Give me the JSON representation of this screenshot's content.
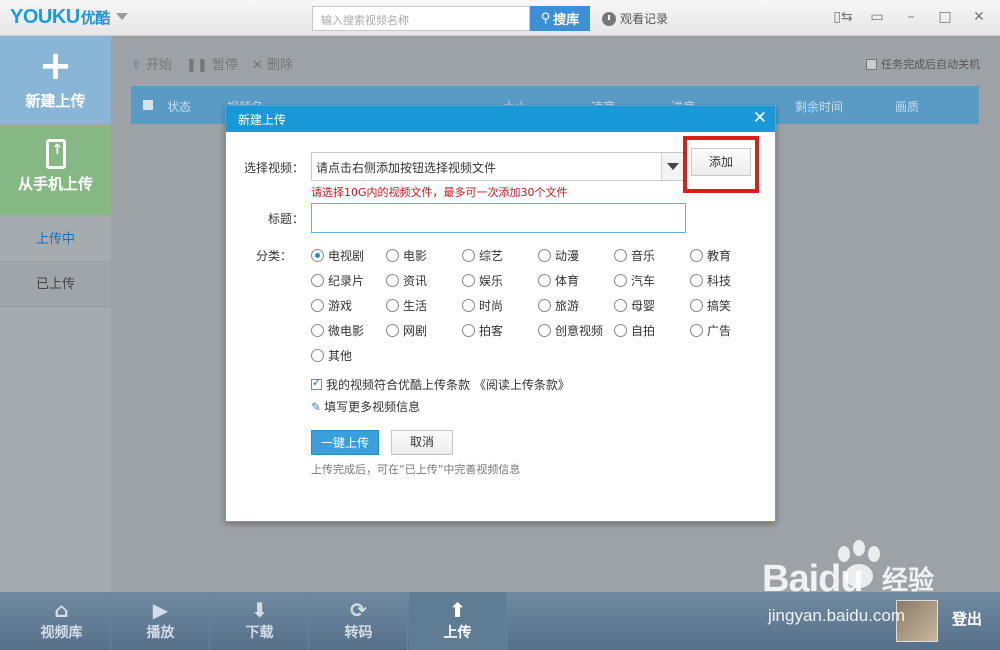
{
  "app": {
    "logo_latin": "YOUKU",
    "logo_cn": "优酷",
    "search_placeholder": "输入搜索视频名称",
    "search_button": "搜库",
    "history": "观看记录"
  },
  "sidebar": {
    "new_upload": "新建上传",
    "phone_upload": "从手机上传",
    "tab_uploading": "上传中",
    "tab_uploaded": "已上传"
  },
  "toolbar": {
    "start": "开始",
    "pause": "暂停",
    "delete": "删除",
    "auto_shutdown": "任务完成后自动关机"
  },
  "table": {
    "columns": [
      "状态",
      "视频名",
      "大小",
      "速度",
      "进度",
      "剩余时间",
      "画质"
    ]
  },
  "dialog": {
    "title": "新建上传",
    "select_label": "选择视频：",
    "select_value": "请点击右侧添加按钮选择视频文件",
    "add_button": "添加",
    "hint": "请选择10G内的视频文件，最多可一次添加30个文件",
    "title_label": "标题：",
    "category_label": "分类：",
    "categories": [
      "电视剧",
      "电影",
      "综艺",
      "动漫",
      "音乐",
      "教育",
      "纪录片",
      "资讯",
      "娱乐",
      "体育",
      "汽车",
      "科技",
      "游戏",
      "生活",
      "时尚",
      "旅游",
      "母婴",
      "搞笑",
      "微电影",
      "网剧",
      "拍客",
      "创意视频",
      "自拍",
      "广告",
      "其他"
    ],
    "selected_category": "电视剧",
    "agree_text": "我的视频符合优酷上传条款 《阅读上传条款》",
    "more_info": "填写更多视频信息",
    "upload_button": "一键上传",
    "cancel_button": "取消",
    "footnote": "上传完成后，可在“已上传”中完善视频信息"
  },
  "bottom_nav": {
    "items": [
      "视频库",
      "播放",
      "下载",
      "转码",
      "上传"
    ],
    "active": "上传",
    "logout": "登出"
  },
  "watermark": {
    "brand": "Baidu",
    "brand_cn": "经验",
    "url": "jingyan.baidu.com"
  }
}
